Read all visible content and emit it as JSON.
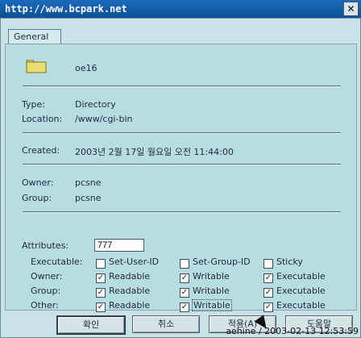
{
  "window": {
    "title": "http://www.bcpark.net",
    "close_glyph": "✕"
  },
  "tabs": [
    {
      "label": "General"
    }
  ],
  "file": {
    "name": "oe16"
  },
  "info": {
    "type_label": "Type:",
    "type_value": "Directory",
    "location_label": "Location:",
    "location_value": "/www/cgi-bin",
    "created_label": "Created:",
    "created_value": "2003년 2월 17일 월요일 오전 11:44:00",
    "owner_label": "Owner:",
    "owner_value": "pcsne",
    "group_label": "Group:",
    "group_value": "pcsne",
    "attributes_label": "Attributes:",
    "attributes_value": "777"
  },
  "permissions": {
    "executable_label": "Executable:",
    "special_flags": [
      {
        "label": "Set-User-ID",
        "checked": false
      },
      {
        "label": "Set-Group-ID",
        "checked": false
      },
      {
        "label": "Sticky",
        "checked": false
      }
    ],
    "rows": [
      {
        "label": "Owner:",
        "readable": true,
        "writable": true,
        "executable": true
      },
      {
        "label": "Group:",
        "readable": true,
        "writable": true,
        "executable": true
      },
      {
        "label": "Other:",
        "readable": true,
        "writable": true,
        "executable": true
      }
    ],
    "readable_label": "Readable",
    "writable_label": "Writable",
    "executable_label_col": "Executable"
  },
  "buttons": [
    {
      "label": "확인"
    },
    {
      "label": "취소"
    },
    {
      "label": "적용(A)"
    },
    {
      "label": "도움말"
    }
  ],
  "watermark": {
    "text": "aehine / 2003-02-13 12:53:59"
  },
  "icons": {
    "folder": "folder-icon",
    "close": "close-icon",
    "cursor": "mouse-cursor-icon"
  }
}
